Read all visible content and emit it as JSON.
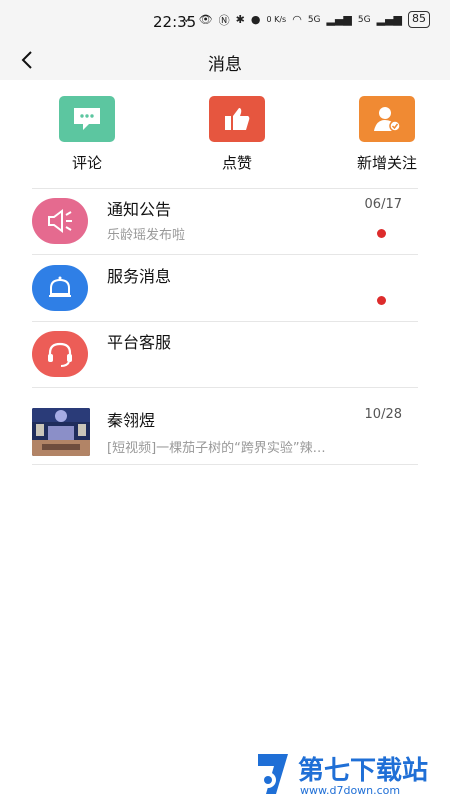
{
  "status_bar": {
    "time": "22:35",
    "speed": "0 K/s",
    "network1": "5G",
    "network2": "5G",
    "battery": "85"
  },
  "header": {
    "title": "消息",
    "back_icon": "chevron-left-icon"
  },
  "shortcuts": [
    {
      "label": "评论",
      "icon": "chat-bubble-icon",
      "color": "#5cc6a0"
    },
    {
      "label": "点赞",
      "icon": "thumbs-up-icon",
      "color": "#e6563f"
    },
    {
      "label": "新增关注",
      "icon": "add-follower-icon",
      "color": "#f08a33"
    }
  ],
  "messages": [
    {
      "title": "通知公告",
      "subtitle": "乐龄瑶发布啦",
      "date": "06/17",
      "unread": true,
      "icon": "megaphone-icon",
      "color": "#e56a8f"
    },
    {
      "title": "服务消息",
      "subtitle": "",
      "date": "",
      "unread": true,
      "icon": "bell-icon",
      "color": "#2f7fe6"
    },
    {
      "title": "平台客服",
      "subtitle": "",
      "date": "",
      "unread": false,
      "icon": "headset-icon",
      "color": "#ec5d57"
    },
    {
      "title": "秦翎煜",
      "subtitle": "[短视频]一棵茄子树的“跨界实验”辣…",
      "date": "10/28",
      "unread": false,
      "icon": "video-thumbnail"
    }
  ],
  "watermark": {
    "brand": "第七下载站",
    "url": "www.d7down.com"
  }
}
